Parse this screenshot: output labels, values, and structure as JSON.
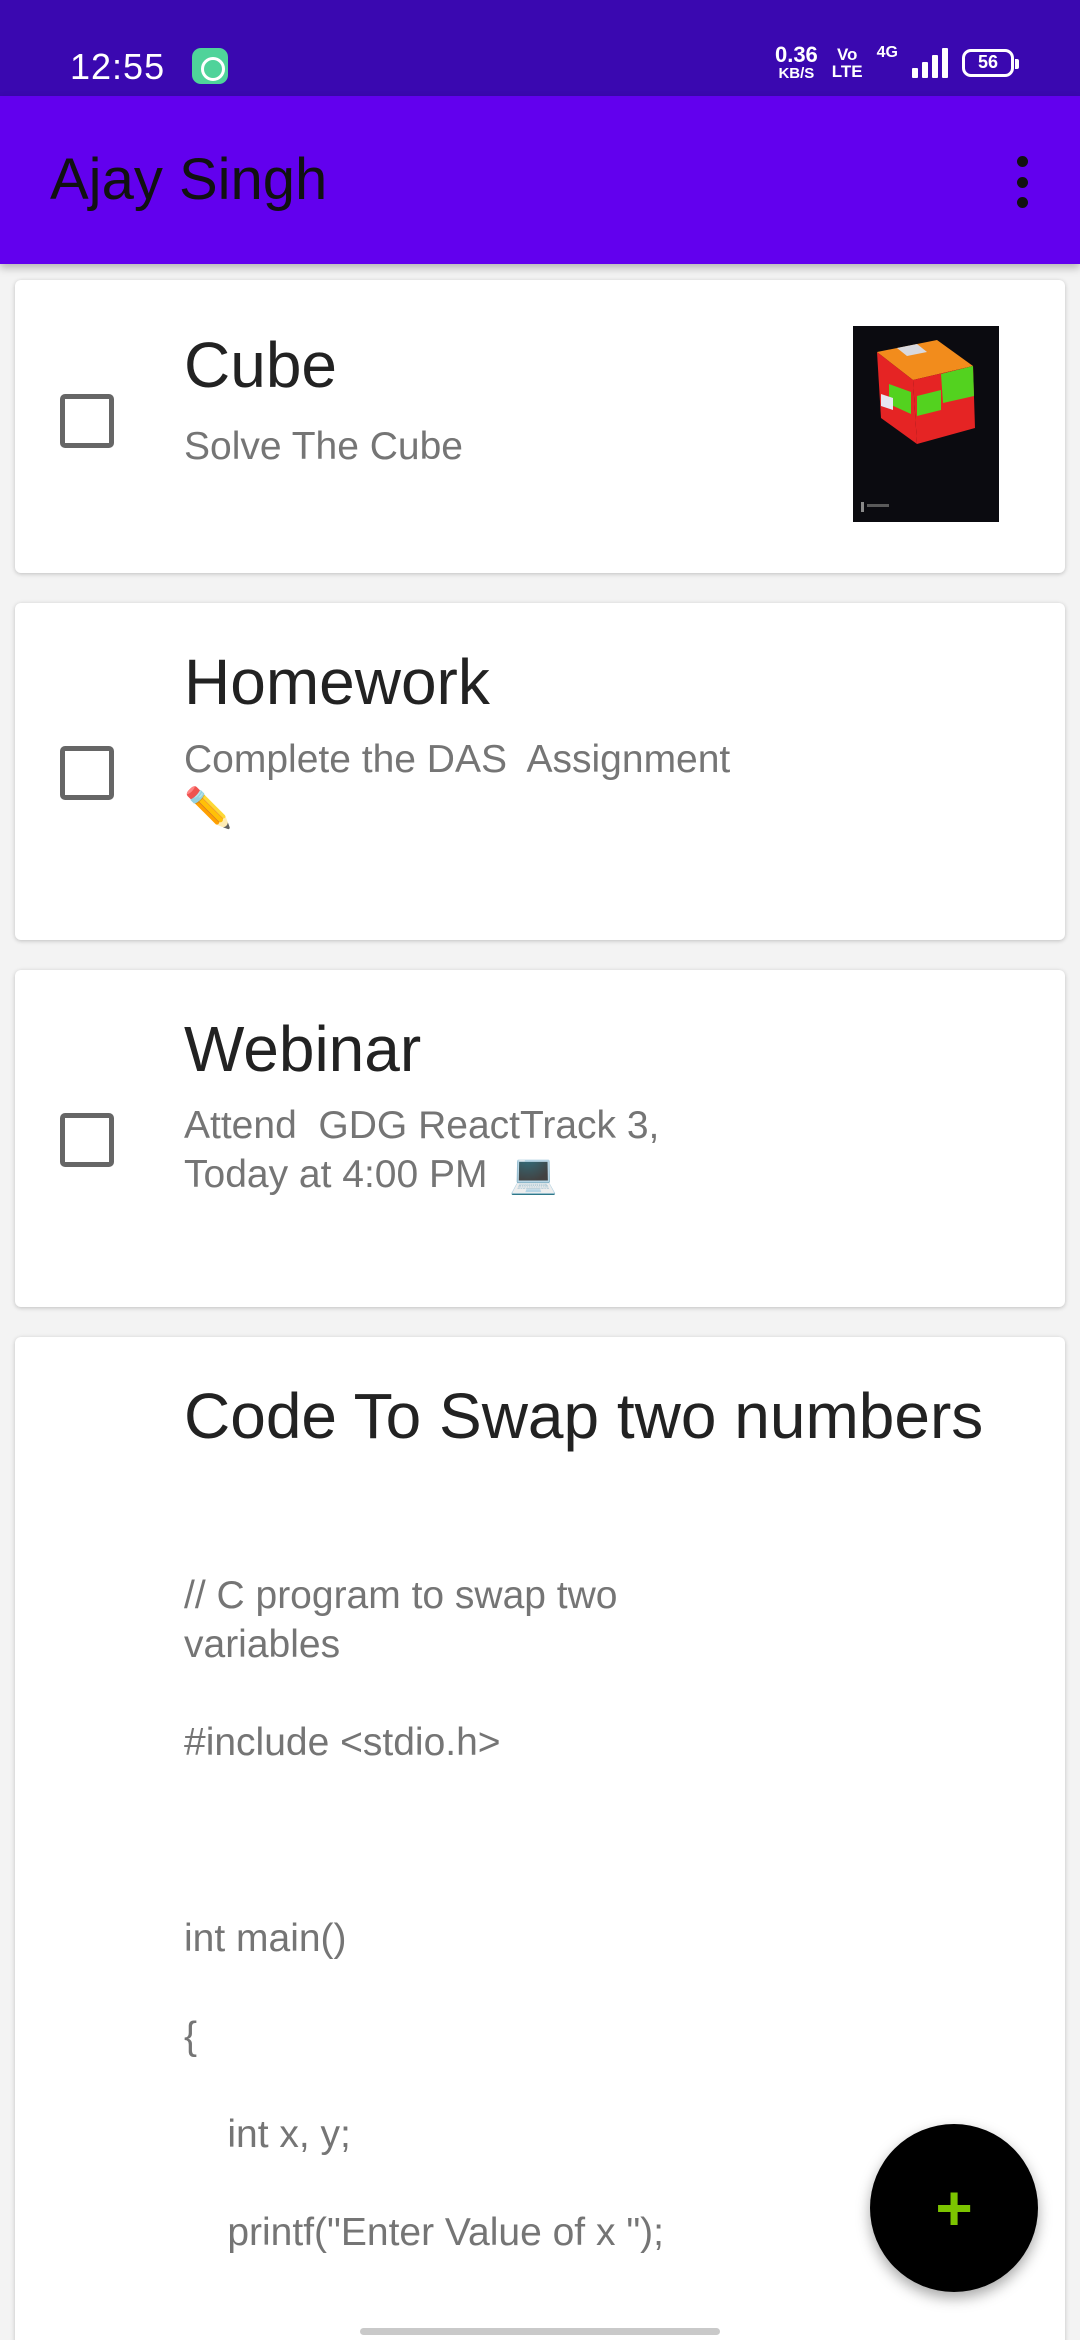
{
  "status_bar": {
    "time": "12:55",
    "net_speed_value": "0.36",
    "net_speed_unit": "KB/S",
    "volte_top": "Vo",
    "volte_bottom": "LTE",
    "network": "4G",
    "battery": "56"
  },
  "app_bar": {
    "title": "Ajay Singh",
    "menu_icon": "more-vert-icon"
  },
  "notes": [
    {
      "title": "Cube",
      "body": "Solve The Cube",
      "has_checkbox": true,
      "checked": false,
      "has_image": true
    },
    {
      "title": "Homework",
      "body": "Complete the DAS  Assignment\n✏️",
      "has_checkbox": true,
      "checked": false
    },
    {
      "title": "Webinar",
      "body": "Attend  GDG ReactTrack 3,\nToday at 4:00 PM  💻",
      "has_checkbox": true,
      "checked": false
    },
    {
      "title": "Code To Swap two\nnumbers",
      "body": "// C program to swap two\nvariables\n\n#include <stdio.h>\n\n\n\nint main()\n\n{\n\n    int x, y;\n\n    printf(\"Enter Value of x \");",
      "has_checkbox": false
    }
  ],
  "fab": {
    "label": "+",
    "icon": "add-icon",
    "color": "#7cc400"
  },
  "colors": {
    "status_bar": "#3a08b0",
    "app_bar": "#6200ee"
  }
}
